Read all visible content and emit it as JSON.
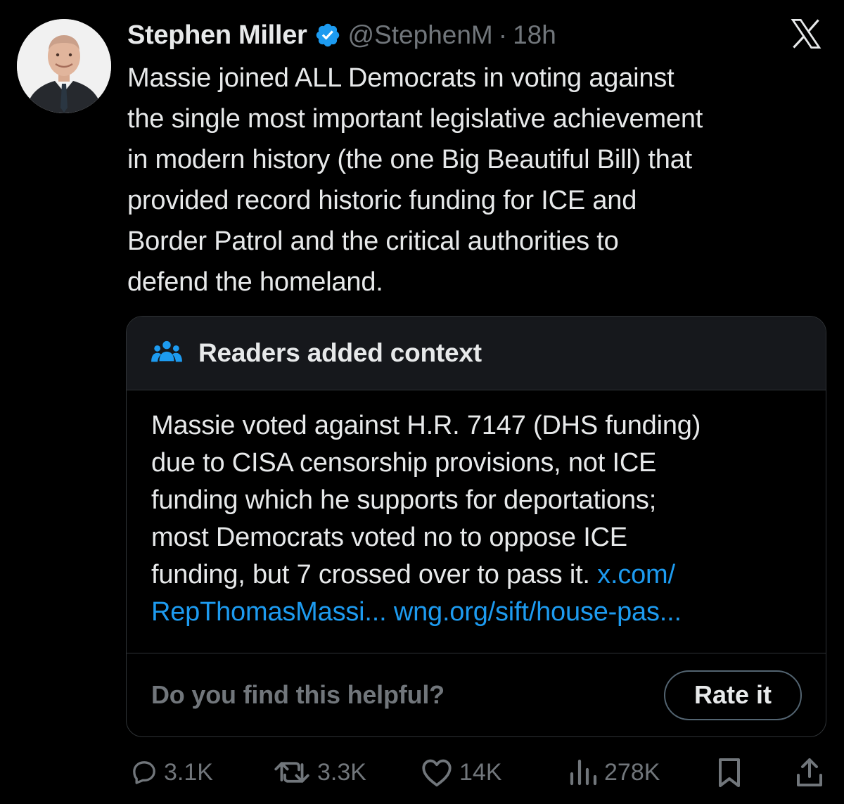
{
  "author": {
    "name": "Stephen Miller",
    "handle": "@StephenM",
    "separator": "·",
    "time": "18h"
  },
  "tweet": {
    "lines": [
      "Massie joined ALL Democrats in voting against",
      "the single most important legislative achievement",
      "in modern history (the one Big Beautiful Bill) that",
      "provided record historic funding for ICE and",
      "Border Patrol and the critical authorities to",
      "defend the homeland."
    ]
  },
  "note": {
    "title": "Readers added context",
    "lines": [
      "Massie voted against H.R. 7147 (DHS funding)",
      "due to CISA censorship provisions, not ICE",
      "funding which he supports for deportations;",
      "most Democrats voted no to oppose ICE",
      "funding, but 7 crossed over to pass it."
    ],
    "link1_part1": "x.com/",
    "link1_part2": "RepThomasMassi...",
    "link2": "wng.org/sift/house-pas...",
    "helpful_question": "Do you find this helpful?",
    "rate_button": "Rate it"
  },
  "actions": {
    "replies": "3.1K",
    "reposts": "3.3K",
    "likes": "14K",
    "views": "278K"
  },
  "icons": {
    "verified": "verified-badge-icon",
    "x_logo": "x-logo-icon",
    "note": "people-icon",
    "reply": "reply-icon",
    "repost": "repost-icon",
    "like": "heart-icon",
    "views": "analytics-icon",
    "bookmark": "bookmark-icon",
    "share": "share-icon"
  },
  "colors": {
    "background": "#000000",
    "text": "#e7e9ea",
    "muted": "#71767b",
    "accent": "#1d9bf0",
    "border": "#2f3336"
  }
}
